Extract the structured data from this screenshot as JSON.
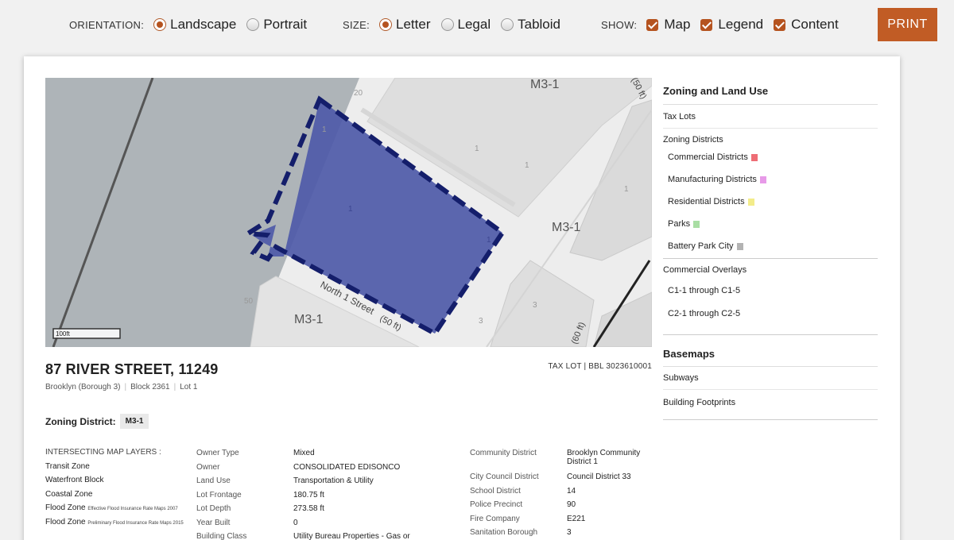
{
  "toolbar": {
    "orientation": {
      "label": "ORIENTATION:",
      "options": [
        "Landscape",
        "Portrait"
      ],
      "selected": "Landscape"
    },
    "size": {
      "label": "SIZE:",
      "options": [
        "Letter",
        "Legal",
        "Tabloid"
      ],
      "selected": "Letter"
    },
    "show": {
      "label": "SHOW:",
      "options": [
        "Map",
        "Legend",
        "Content"
      ],
      "checked": [
        "Map",
        "Legend",
        "Content"
      ]
    },
    "print_label": "PRINT"
  },
  "map": {
    "district_labels": [
      "M3-1",
      "M3-1",
      "M3-1"
    ],
    "lot_numbers": [
      "1",
      "1",
      "1",
      "1",
      "1",
      "1",
      "3",
      "3",
      "50",
      "20"
    ],
    "street_label": "North 1 Street",
    "street_width": "(50 ft)",
    "width_label_right": "(50 ft)",
    "width_label_bottom": "(60 ft)",
    "scale_label": "100ft",
    "colors": {
      "water": "#aeb4b8",
      "land": "#ededed",
      "block": "#dedede",
      "lot_fill": "#4e5aa8",
      "lot_stroke": "#141e6b"
    }
  },
  "legend": {
    "zoning_title": "Zoning and Land Use",
    "tax_lots": "Tax Lots",
    "zoning_districts": "Zoning Districts",
    "districts": [
      {
        "label": "Commercial Districts",
        "color": "#ee6d75"
      },
      {
        "label": "Manufacturing Districts",
        "color": "#e79ae8"
      },
      {
        "label": "Residential Districts",
        "color": "#f3ec8a"
      },
      {
        "label": "Parks",
        "color": "#a9dea4"
      },
      {
        "label": "Battery Park City",
        "color": "#b3b3b3"
      }
    ],
    "commercial_overlays": "Commercial Overlays",
    "overlays": [
      "C1-1 through C1-5",
      "C2-1 through C2-5"
    ],
    "basemaps_title": "Basemaps",
    "basemaps": [
      "Subways",
      "Building Footprints"
    ]
  },
  "lot": {
    "address": "87 RIVER STREET, 11249",
    "tax_lot": "TAX LOT | BBL 3023610001",
    "borough": "Brooklyn (Borough 3)",
    "block": "Block 2361",
    "lot": "Lot 1",
    "zoning_label": "Zoning District:",
    "zoning_value": "M3-1"
  },
  "layers": {
    "title": "INTERSECTING MAP LAYERS :",
    "items": [
      "Transit Zone",
      "Waterfront Block",
      "Coastal Zone",
      "Flood Zone",
      "Flood Zone"
    ],
    "flood_notes": [
      "Effective Flood Insurance Rate Maps 2007",
      "Preliminary Flood Insurance Rate Maps 2015"
    ]
  },
  "details": {
    "labels": [
      "Owner Type",
      "Owner",
      "Land Use",
      "Lot Frontage",
      "Lot Depth",
      "Year Built",
      "Building Class"
    ],
    "values": [
      "Mixed",
      "CONSOLIDATED EDISONCO",
      "Transportation & Utility",
      "180.75 ft",
      "273.58 ft",
      "0",
      "Utility Bureau Properties - Gas or"
    ]
  },
  "districts": {
    "labels": [
      "Community District",
      "City Council District",
      "School District",
      "Police Precinct",
      "Fire Company",
      "Sanitation Borough"
    ],
    "values": [
      "Brooklyn Community District 1",
      "Council District 33",
      "14",
      "90",
      "E221",
      "3"
    ]
  }
}
